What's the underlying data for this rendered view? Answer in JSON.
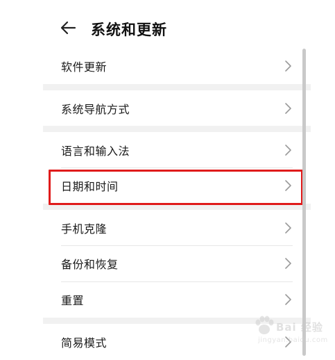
{
  "header": {
    "title": "系统和更新",
    "back_icon": "arrow-left-icon"
  },
  "settings": {
    "items": [
      {
        "label": "软件更新"
      },
      {
        "label": "系统导航方式"
      },
      {
        "label": "语言和输入法"
      },
      {
        "label": "日期和时间"
      },
      {
        "label": "手机克隆"
      },
      {
        "label": "备份和恢复"
      },
      {
        "label": "重置"
      },
      {
        "label": "简易模式"
      }
    ],
    "chevron_icon": "chevron-right-icon",
    "highlighted_item": "日期和时间"
  },
  "highlight_color": "#e01b1b",
  "watermark": {
    "text": "Bai 经验",
    "sub": "jingyan.baidu.com"
  }
}
